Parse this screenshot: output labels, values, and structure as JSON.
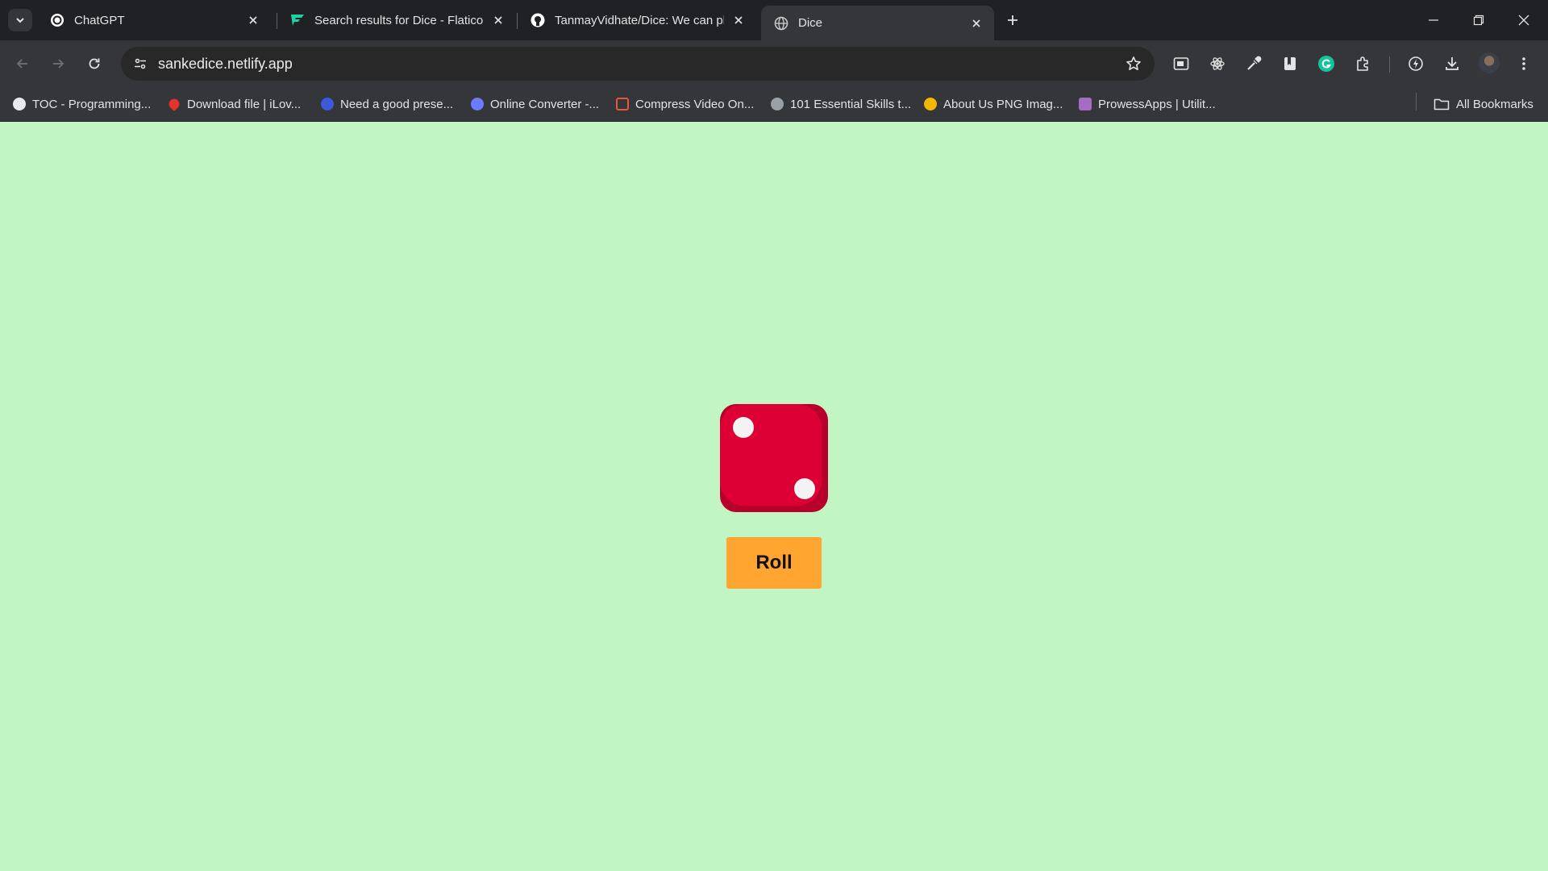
{
  "browser": {
    "tabs": [
      {
        "title": "ChatGPT",
        "icon": "chatgpt-icon",
        "active": false
      },
      {
        "title": "Search results for Dice - Flaticon",
        "icon": "flaticon-icon",
        "active": false
      },
      {
        "title": "TanmayVidhate/Dice: We can play",
        "icon": "github-icon",
        "active": false
      },
      {
        "title": "Dice",
        "icon": "globe-icon",
        "active": true
      }
    ],
    "url": "sankedice.netlify.app",
    "bookmarks": [
      {
        "label": "TOC - Programming...",
        "icon": "toc-icon",
        "color": "#e8eaed"
      },
      {
        "label": "Download file | iLov...",
        "icon": "heart-icon",
        "color": "#e5322d"
      },
      {
        "label": "Need a good prese...",
        "icon": "circle-icon",
        "color": "#3b5bdb"
      },
      {
        "label": "Online Converter -...",
        "icon": "converter-icon",
        "color": "#6c7bff"
      },
      {
        "label": "Compress Video On...",
        "icon": "video-icon",
        "color": "#e8563a"
      },
      {
        "label": "101 Essential Skills t...",
        "icon": "globe-icon",
        "color": "#9aa0a6"
      },
      {
        "label": "About Us PNG Imag...",
        "icon": "png-icon",
        "color": "#f2b705"
      },
      {
        "label": "ProwessApps | Utilit...",
        "icon": "prowess-icon",
        "color": "#a56cc1"
      }
    ],
    "all_bookmarks_label": "All Bookmarks"
  },
  "app": {
    "background": "#c1f6c4",
    "dice": {
      "value": 2,
      "color": "#dc0035",
      "pip_color": "#f3f3f3"
    },
    "roll_label": "Roll",
    "roll_color": "#ffa530"
  }
}
